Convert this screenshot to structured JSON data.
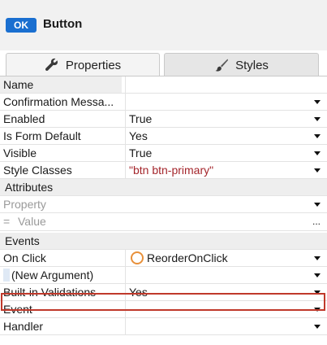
{
  "header": {
    "badge": "OK",
    "title": "Button"
  },
  "tabs": [
    {
      "label": "Properties",
      "icon": "wrench-icon",
      "active": true
    },
    {
      "label": "Styles",
      "icon": "brush-icon",
      "active": false
    }
  ],
  "properties": [
    {
      "name": "Name",
      "value": ""
    },
    {
      "name": "Confirmation Messa...",
      "value": ""
    },
    {
      "name": "Enabled",
      "value": "True"
    },
    {
      "name": "Is Form Default",
      "value": "Yes"
    },
    {
      "name": "Visible",
      "value": "True"
    },
    {
      "name": "Style Classes",
      "value": "\"btn btn-primary\""
    }
  ],
  "attributes": {
    "section": "Attributes",
    "property_placeholder": "Property",
    "eq": "=",
    "value_placeholder": "Value",
    "ellipsis": "..."
  },
  "events": {
    "section": "Events",
    "rows": [
      {
        "name": "On Click",
        "value": "ReorderOnClick"
      },
      {
        "name": "(New Argument)",
        "value": ""
      },
      {
        "name": "Built-in Validations",
        "value": "Yes"
      },
      {
        "name": "Event",
        "value": ""
      },
      {
        "name": "Handler",
        "value": ""
      }
    ]
  },
  "colors": {
    "accent": "#1a6fd0",
    "highlight": "#c0392b",
    "string_value": "#a4262c",
    "action_icon": "#e8903a"
  }
}
